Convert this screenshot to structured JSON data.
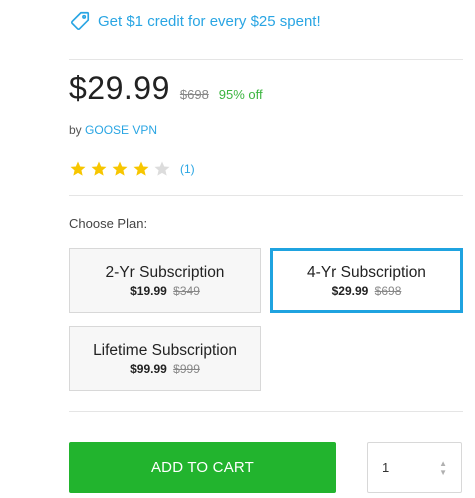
{
  "promo": {
    "icon": "tag-icon",
    "text": "Get $1 credit for every $25 spent!"
  },
  "product": {
    "price": "$29.99",
    "original_price": "$698",
    "discount": "95% off",
    "seller_prefix": "by",
    "seller": "GOOSE VPN",
    "rating": {
      "filled_stars": 4,
      "max_stars": 5,
      "review_count": "(1)"
    }
  },
  "plans": {
    "label": "Choose Plan:",
    "options": [
      {
        "name": "2-Yr Subscription",
        "price": "$19.99",
        "original": "$349",
        "selected": false
      },
      {
        "name": "4-Yr Subscription",
        "price": "$29.99",
        "original": "$698",
        "selected": true
      },
      {
        "name": "Lifetime Subscription",
        "price": "$99.99",
        "original": "$999",
        "selected": false
      }
    ]
  },
  "cart": {
    "button_label": "ADD TO CART",
    "quantity": "1"
  },
  "colors": {
    "accent": "#29a5e3",
    "discount": "#3cb540",
    "cart_button": "#22b42e",
    "selected_border": "#1fa3e0",
    "star": "#f7c600"
  }
}
